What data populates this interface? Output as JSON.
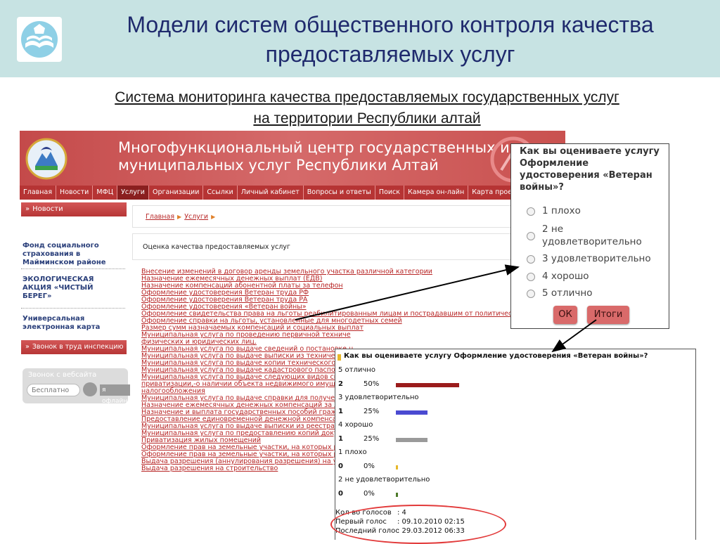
{
  "slide": {
    "title_line1": "Модели систем общественного контроля качества",
    "title_line2": "предоставляемых  услуг",
    "subtitle_line1": "Система мониторинга качества предоставляемых государственных услуг",
    "subtitle_line2": "на территории Республики алтай"
  },
  "site": {
    "title_line1": "Многофункциональный центр государственных и",
    "title_line2": "муниципальных услуг Республики Алтай",
    "nav": [
      "Главная",
      "Новости",
      "МФЦ",
      "Услуги",
      "Организации",
      "Ссылки",
      "Личный кабинет",
      "Вопросы и ответы",
      "Поиск",
      "Камера он-лайн",
      "Карта проезда"
    ],
    "nav_active": "Услуги",
    "sidebar": {
      "news_label": "Новости",
      "links": [
        "Фонд социального страхования в Майминском районе",
        "ЭКОЛОГИЧЕСКАЯ АКЦИЯ «ЧИСТЫЙ БЕРЕГ»",
        "Универсальная электронная карта"
      ],
      "call_label": "Звонок в труд инспекцию",
      "webcall_title": "Звонок с вебсайта",
      "webcall_free": "Бесплатно",
      "webcall_offline": "я офлайн"
    },
    "breadcrumb": [
      "Главная",
      "Услуги"
    ],
    "page_heading": "Оценка качества предоставляемых услуг",
    "services": [
      "Внесение изменений в договор аренды земельного участка различной категории",
      "Назначение ежемесячных денежных выплат (ЕДВ)",
      "Назначение компенсаций абонентной платы за телефон",
      "Оформление удостоверения Ветеран труда РФ",
      "Оформление удостоверения Ветеран труда РА",
      "Оформление удостоверения «Ветеран войны»",
      "Оформление свидетельства права на льготы реабилитированным лицам и пострадавшим от политических репр",
      "Оформление справки на льготы, установленные для многодетных семей",
      "Размер сумм назначаемых компенсаций и социальных выплат",
      "Муниципальная услуга по проведению первичной техниче",
      "физических и юридических лиц.",
      "Муниципальная услуга по выдаче сведений о постановке н",
      "Муниципальная услуга по выдаче выписки из техническог",
      "Муниципальная услуга по выдаче копии технического пас",
      "Муниципальная услуга по выдаче кадастрового паспорта",
      "Муниципальная услуга по выдаче следующих видов справ",
      "приватизации,-о наличии объекта недвижимого имущест",
      "налогообложения",
      "Муниципальная услуга по выдаче справки для получения",
      "Назначение ежемесячных денежных компенсаций за ЖКУ",
      "Назначение и выплата государственных пособий граждан",
      "Предоставление единовременной денежной компенсации",
      "Муниципальная услуга по выдаче выписки из реестра мун",
      "Муниципальная услуга по предоставлению копий докумен",
      "Приватизация жилых помещений",
      "Оформление прав на земельные участки, на которых расп",
      "Оформление прав на земельные участки, на которых расп",
      "Выдача разрешения (аннулирования разрешения) на устан",
      "Выдача разрешения на строительство"
    ]
  },
  "poll": {
    "question": "Как вы оцениваете услугу Оформление удостоверения «Ветеран войны»?",
    "options": [
      "1 плохо",
      "2 не удовлетворительно",
      "3 удовлетворительно",
      "4 хорошо",
      "5 отлично"
    ],
    "ok_label": "ОК",
    "results_label": "Итоги"
  },
  "results": {
    "title": "Как вы оцениваете услугу Оформление удостоверения «Ветеран войны»?",
    "rows": [
      {
        "label": "5 отлично",
        "count": "2",
        "percent": "50%",
        "fraction": 0.5,
        "color": "#9b1c1c"
      },
      {
        "label": "3 удовлетворительно",
        "count": "1",
        "percent": "25%",
        "fraction": 0.25,
        "color": "#4a4ad1"
      },
      {
        "label": "4 хорошо",
        "count": "1",
        "percent": "25%",
        "fraction": 0.25,
        "color": "#9a9a9a"
      },
      {
        "label": "1 плохо",
        "count": "0",
        "percent": "0%",
        "fraction": 0,
        "color": "#e7b82a"
      },
      {
        "label": "2 не удовлетворительно",
        "count": "0",
        "percent": "0%",
        "fraction": 0,
        "color": "#4d7a2a"
      }
    ],
    "stats": [
      {
        "label": "Кол-во голосов",
        "value": ":  4"
      },
      {
        "label": "Первый голос",
        "value": ":  09.10.2010 02:15"
      },
      {
        "label": "Последний голос",
        "value": ":  29.03.2012 06:33"
      }
    ]
  }
}
